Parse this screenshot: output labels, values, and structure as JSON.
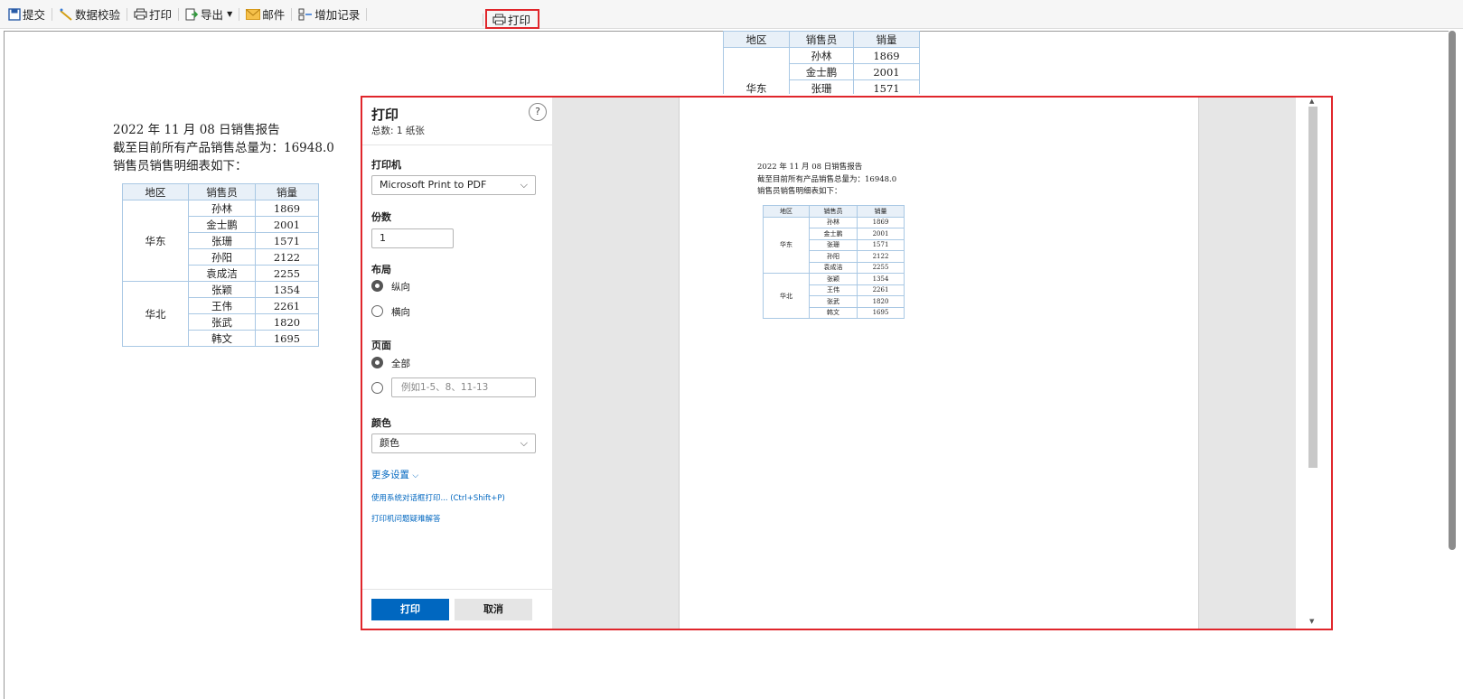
{
  "toolbar": {
    "submit": "提交",
    "validate": "数据校验",
    "print": "打印",
    "export": "导出",
    "email": "邮件",
    "add_record": "增加记录",
    "print2": "打印"
  },
  "report": {
    "line1": "2022 年 11 月 08 日销售报告",
    "line2": "截至目前所有产品销售总量为：16948.0",
    "line3": "销售员销售明细表如下：",
    "headers": [
      "地区",
      "销售员",
      "销量"
    ],
    "regions": [
      "华东",
      "华北"
    ],
    "rows": [
      {
        "seller": "孙林",
        "qty": "1869"
      },
      {
        "seller": "金士鹏",
        "qty": "2001"
      },
      {
        "seller": "张珊",
        "qty": "1571"
      },
      {
        "seller": "孙阳",
        "qty": "2122"
      },
      {
        "seller": "袁成洁",
        "qty": "2255"
      },
      {
        "seller": "张颖",
        "qty": "1354"
      },
      {
        "seller": "王伟",
        "qty": "2261"
      },
      {
        "seller": "张武",
        "qty": "1820"
      },
      {
        "seller": "韩文",
        "qty": "1695"
      }
    ]
  },
  "print_dialog": {
    "title": "打印",
    "subtitle": "总数: 1 纸张",
    "help": "?",
    "printer_label": "打印机",
    "printer_value": "Microsoft Print to PDF",
    "copies_label": "份数",
    "copies_value": "1",
    "layout_label": "布局",
    "portrait": "纵向",
    "landscape": "横向",
    "pages_label": "页面",
    "pages_all": "全部",
    "pages_placeholder": "例如1-5、8、11-13",
    "color_label": "颜色",
    "color_value": "颜色",
    "more_settings": "更多设置",
    "system_dialog": "使用系统对话框打印... (Ctrl+Shift+P)",
    "troubleshoot": "打印机问题疑难解答",
    "print_button": "打印",
    "cancel_button": "取消"
  }
}
